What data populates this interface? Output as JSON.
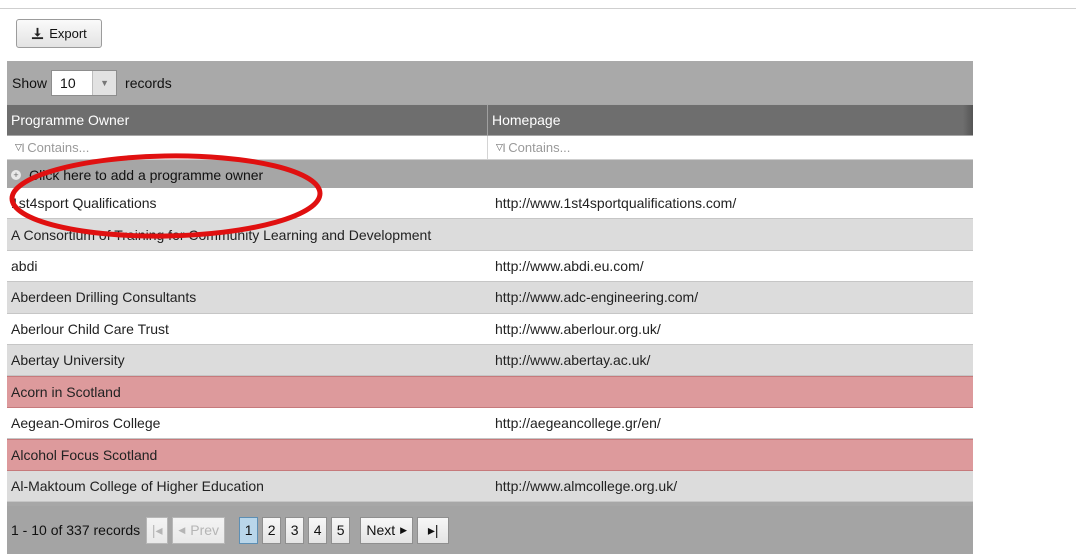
{
  "toolbar": {
    "export_label": "Export"
  },
  "grid": {
    "show_label": "Show",
    "page_size": "10",
    "records_label": "records",
    "columns": [
      "Programme Owner",
      "Homepage"
    ],
    "filter_placeholder": "Contains...",
    "add_label": "Click here to add a programme owner",
    "rows": [
      {
        "owner": "1st4sport Qualifications",
        "homepage": "http://www.1st4sportqualifications.com/",
        "style": "odd"
      },
      {
        "owner": "A Consortium of Training for Community Learning and Development",
        "homepage": "",
        "style": "even"
      },
      {
        "owner": "abdi",
        "homepage": "http://www.abdi.eu.com/",
        "style": "odd"
      },
      {
        "owner": "Aberdeen Drilling Consultants",
        "homepage": "http://www.adc-engineering.com/",
        "style": "even"
      },
      {
        "owner": "Aberlour Child Care Trust",
        "homepage": "http://www.aberlour.org.uk/",
        "style": "odd"
      },
      {
        "owner": "Abertay University",
        "homepage": "http://www.abertay.ac.uk/",
        "style": "even"
      },
      {
        "owner": "Acorn in Scotland",
        "homepage": "",
        "style": "flag"
      },
      {
        "owner": "Aegean-Omiros College",
        "homepage": "http://aegeancollege.gr/en/",
        "style": "odd"
      },
      {
        "owner": "Alcohol Focus Scotland",
        "homepage": "",
        "style": "flag"
      },
      {
        "owner": "Al-Maktoum College of Higher Education",
        "homepage": "http://www.almcollege.org.uk/",
        "style": "even"
      }
    ]
  },
  "pager": {
    "info": "1 - 10 of 337 records",
    "prev_label": "Prev",
    "next_label": "Next",
    "pages": [
      "1",
      "2",
      "3",
      "4",
      "5"
    ],
    "current_page": "1"
  },
  "colors": {
    "header_bg": "#6e6e6e",
    "flag_row": "#dd9a9c",
    "annotation_ellipse": "#e01010",
    "active_page": "#b9d6ea"
  }
}
